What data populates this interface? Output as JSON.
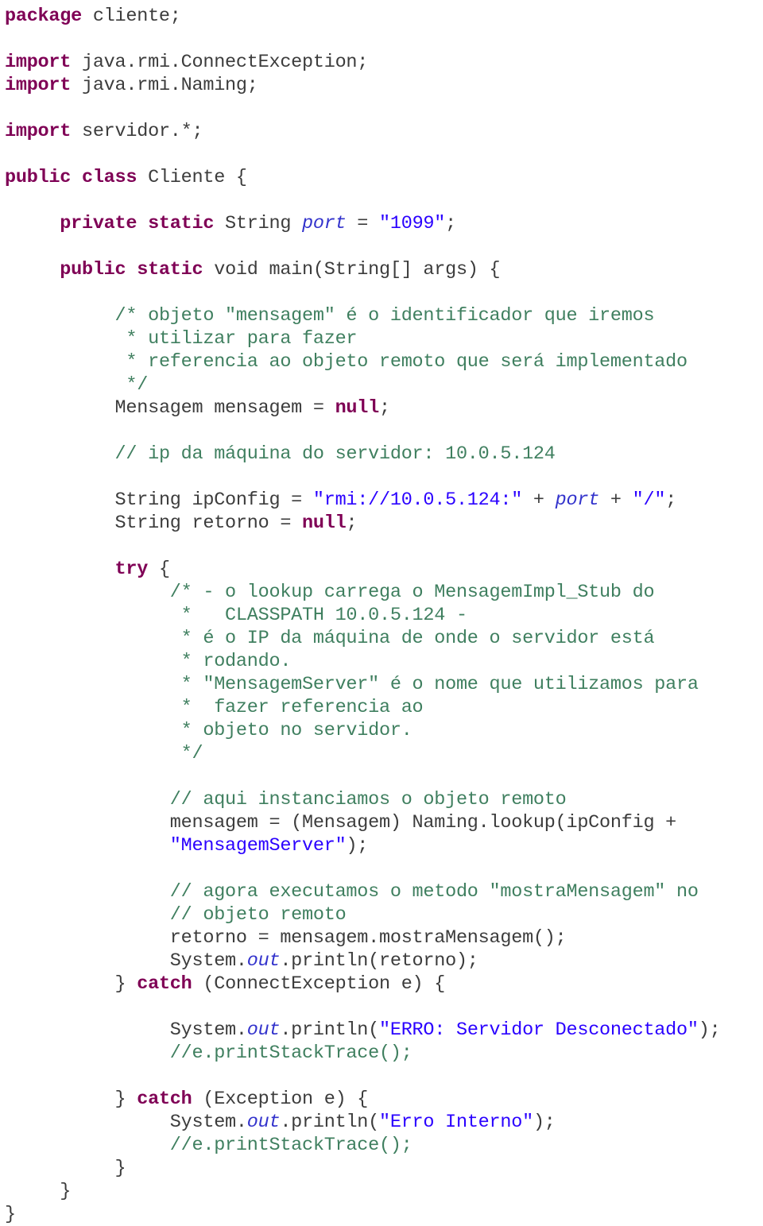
{
  "document": {
    "kind": "java-source-listing",
    "language": "Java",
    "package": "cliente",
    "class_name": "Cliente",
    "background_color": "#ffffff",
    "colors": {
      "keyword": "#7f0055",
      "string": "#2a00ff",
      "comment": "#3f7f5f",
      "field": "#3333cc",
      "plain": "#3c3c3c"
    }
  },
  "code": {
    "lines": [
      {
        "indent": 0,
        "tokens": [
          {
            "t": "kw",
            "v": "package"
          },
          {
            "t": "pln",
            "v": " cliente;"
          }
        ]
      },
      {
        "indent": 0,
        "tokens": []
      },
      {
        "indent": 0,
        "tokens": [
          {
            "t": "kw",
            "v": "import"
          },
          {
            "t": "pln",
            "v": " java.rmi.ConnectException;"
          }
        ]
      },
      {
        "indent": 0,
        "tokens": [
          {
            "t": "kw",
            "v": "import"
          },
          {
            "t": "pln",
            "v": " java.rmi.Naming;"
          }
        ]
      },
      {
        "indent": 0,
        "tokens": []
      },
      {
        "indent": 0,
        "tokens": [
          {
            "t": "kw",
            "v": "import"
          },
          {
            "t": "pln",
            "v": " servidor.*;"
          }
        ]
      },
      {
        "indent": 0,
        "tokens": []
      },
      {
        "indent": 0,
        "tokens": [
          {
            "t": "kw",
            "v": "public class"
          },
          {
            "t": "pln",
            "v": " Cliente {"
          }
        ]
      },
      {
        "indent": 0,
        "tokens": []
      },
      {
        "indent": 5,
        "tokens": [
          {
            "t": "kw",
            "v": "private static"
          },
          {
            "t": "pln",
            "v": " String "
          },
          {
            "t": "fld",
            "v": "port"
          },
          {
            "t": "pln",
            "v": " = "
          },
          {
            "t": "str",
            "v": "\"1099\""
          },
          {
            "t": "pln",
            "v": ";"
          }
        ]
      },
      {
        "indent": 0,
        "tokens": []
      },
      {
        "indent": 5,
        "tokens": [
          {
            "t": "kw",
            "v": "public static"
          },
          {
            "t": "pln",
            "v": " void main(String[] args) {"
          }
        ]
      },
      {
        "indent": 0,
        "tokens": []
      },
      {
        "indent": 10,
        "tokens": [
          {
            "t": "cmt",
            "v": "/* objeto \"mensagem\" é o identificador que iremos"
          }
        ]
      },
      {
        "indent": 10,
        "tokens": [
          {
            "t": "cmt",
            "v": " * utilizar para fazer"
          }
        ]
      },
      {
        "indent": 10,
        "tokens": [
          {
            "t": "cmt",
            "v": " * referencia ao objeto remoto que será implementado"
          }
        ]
      },
      {
        "indent": 10,
        "tokens": [
          {
            "t": "cmt",
            "v": " */"
          }
        ]
      },
      {
        "indent": 10,
        "tokens": [
          {
            "t": "pln",
            "v": "Mensagem mensagem = "
          },
          {
            "t": "kw",
            "v": "null"
          },
          {
            "t": "pln",
            "v": ";"
          }
        ]
      },
      {
        "indent": 0,
        "tokens": []
      },
      {
        "indent": 10,
        "tokens": [
          {
            "t": "cmt",
            "v": "// ip da máquina do servidor: 10.0.5.124"
          }
        ]
      },
      {
        "indent": 0,
        "tokens": []
      },
      {
        "indent": 10,
        "tokens": [
          {
            "t": "pln",
            "v": "String ipConfig = "
          },
          {
            "t": "str",
            "v": "\"rmi://10.0.5.124:\""
          },
          {
            "t": "pln",
            "v": " + "
          },
          {
            "t": "fld",
            "v": "port"
          },
          {
            "t": "pln",
            "v": " + "
          },
          {
            "t": "str",
            "v": "\"/\""
          },
          {
            "t": "pln",
            "v": ";"
          }
        ]
      },
      {
        "indent": 10,
        "tokens": [
          {
            "t": "pln",
            "v": "String retorno = "
          },
          {
            "t": "kw",
            "v": "null"
          },
          {
            "t": "pln",
            "v": ";"
          }
        ]
      },
      {
        "indent": 0,
        "tokens": []
      },
      {
        "indent": 10,
        "tokens": [
          {
            "t": "kw",
            "v": "try"
          },
          {
            "t": "pln",
            "v": " {"
          }
        ]
      },
      {
        "indent": 15,
        "tokens": [
          {
            "t": "cmt",
            "v": "/* - o lookup carrega o MensagemImpl_Stub do"
          }
        ]
      },
      {
        "indent": 15,
        "tokens": [
          {
            "t": "cmt",
            "v": " *   CLASSPATH 10.0.5.124 -"
          }
        ]
      },
      {
        "indent": 15,
        "tokens": [
          {
            "t": "cmt",
            "v": " * é o IP da máquina de onde o servidor está"
          }
        ]
      },
      {
        "indent": 15,
        "tokens": [
          {
            "t": "cmt",
            "v": " * rodando."
          }
        ]
      },
      {
        "indent": 15,
        "tokens": [
          {
            "t": "cmt",
            "v": " * \"MensagemServer\" é o nome que utilizamos para"
          }
        ]
      },
      {
        "indent": 15,
        "tokens": [
          {
            "t": "cmt",
            "v": " *  fazer referencia ao"
          }
        ]
      },
      {
        "indent": 15,
        "tokens": [
          {
            "t": "cmt",
            "v": " * objeto no servidor."
          }
        ]
      },
      {
        "indent": 15,
        "tokens": [
          {
            "t": "cmt",
            "v": " */"
          }
        ]
      },
      {
        "indent": 0,
        "tokens": []
      },
      {
        "indent": 15,
        "tokens": [
          {
            "t": "cmt",
            "v": "// aqui instanciamos o objeto remoto"
          }
        ]
      },
      {
        "indent": 15,
        "tokens": [
          {
            "t": "pln",
            "v": "mensagem = (Mensagem) Naming.lookup(ipConfig +"
          }
        ]
      },
      {
        "indent": 15,
        "tokens": [
          {
            "t": "str",
            "v": "\"MensagemServer\""
          },
          {
            "t": "pln",
            "v": ");"
          }
        ]
      },
      {
        "indent": 0,
        "tokens": []
      },
      {
        "indent": 15,
        "tokens": [
          {
            "t": "cmt",
            "v": "// agora executamos o metodo \"mostraMensagem\" no"
          }
        ]
      },
      {
        "indent": 15,
        "tokens": [
          {
            "t": "cmt",
            "v": "// objeto remoto"
          }
        ]
      },
      {
        "indent": 15,
        "tokens": [
          {
            "t": "pln",
            "v": "retorno = mensagem.mostraMensagem();"
          }
        ]
      },
      {
        "indent": 15,
        "tokens": [
          {
            "t": "pln",
            "v": "System."
          },
          {
            "t": "fld",
            "v": "out"
          },
          {
            "t": "pln",
            "v": ".println(retorno);"
          }
        ]
      },
      {
        "indent": 10,
        "tokens": [
          {
            "t": "pln",
            "v": "} "
          },
          {
            "t": "kw",
            "v": "catch"
          },
          {
            "t": "pln",
            "v": " (ConnectException e) {"
          }
        ]
      },
      {
        "indent": 0,
        "tokens": []
      },
      {
        "indent": 15,
        "tokens": [
          {
            "t": "pln",
            "v": "System."
          },
          {
            "t": "fld",
            "v": "out"
          },
          {
            "t": "pln",
            "v": ".println("
          },
          {
            "t": "str",
            "v": "\"ERRO: Servidor Desconectado\""
          },
          {
            "t": "pln",
            "v": ");"
          }
        ]
      },
      {
        "indent": 15,
        "tokens": [
          {
            "t": "cmt",
            "v": "//e.printStackTrace();"
          }
        ]
      },
      {
        "indent": 0,
        "tokens": []
      },
      {
        "indent": 10,
        "tokens": [
          {
            "t": "pln",
            "v": "} "
          },
          {
            "t": "kw",
            "v": "catch"
          },
          {
            "t": "pln",
            "v": " (Exception e) {"
          }
        ]
      },
      {
        "indent": 15,
        "tokens": [
          {
            "t": "pln",
            "v": "System."
          },
          {
            "t": "fld",
            "v": "out"
          },
          {
            "t": "pln",
            "v": ".println("
          },
          {
            "t": "str",
            "v": "\"Erro Interno\""
          },
          {
            "t": "pln",
            "v": ");"
          }
        ]
      },
      {
        "indent": 15,
        "tokens": [
          {
            "t": "cmt",
            "v": "//e.printStackTrace();"
          }
        ]
      },
      {
        "indent": 10,
        "tokens": [
          {
            "t": "pln",
            "v": "}"
          }
        ]
      },
      {
        "indent": 5,
        "tokens": [
          {
            "t": "pln",
            "v": "}"
          }
        ]
      },
      {
        "indent": 0,
        "tokens": [
          {
            "t": "pln",
            "v": "}"
          }
        ]
      }
    ]
  }
}
